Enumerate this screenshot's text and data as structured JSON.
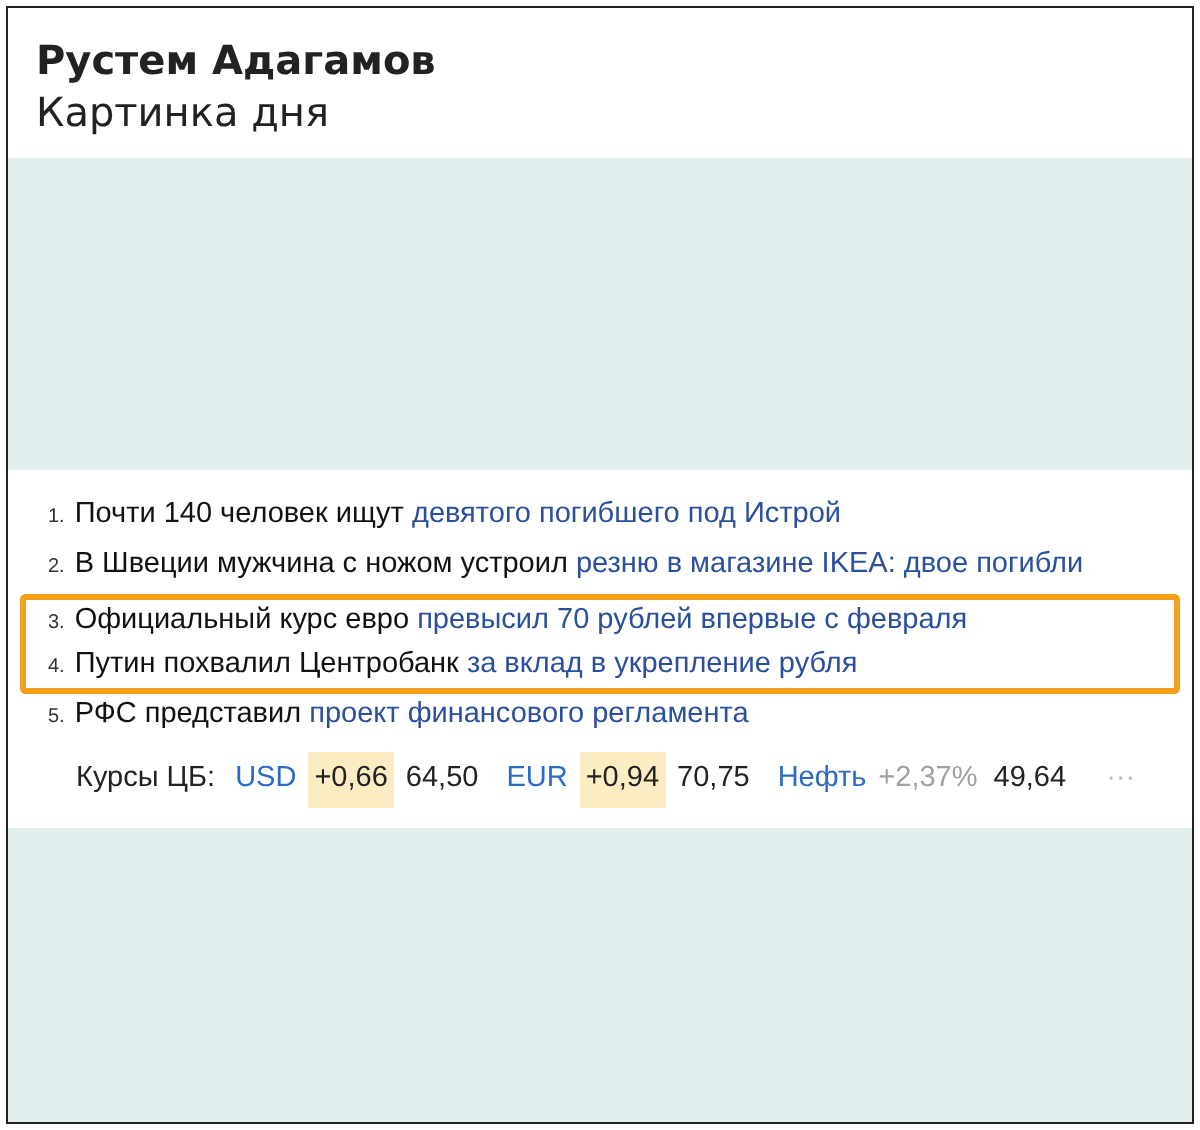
{
  "post": {
    "author": "Рустем Адагамов",
    "subtitle": "Картинка дня"
  },
  "news": [
    {
      "number": "1.",
      "text": "Почти 140 человек ищут",
      "link": "девятого погибшего под Истрой",
      "highlighted": false
    },
    {
      "number": "2.",
      "text": "В Швеции мужчина с ножом устроил",
      "link": "резню в магазине IKEA: двое погибли",
      "highlighted": false
    },
    {
      "number": "3.",
      "text": "Официальный курс евро",
      "link": "превысил 70 рублей впервые с февраля",
      "highlighted": true
    },
    {
      "number": "4.",
      "text": "Путин похвалил Центробанк",
      "link": "за вклад в укрепление рубля",
      "highlighted": true
    },
    {
      "number": "5.",
      "text": "РФС представил",
      "link": "проект финансового регламента",
      "highlighted": false
    }
  ],
  "rates": {
    "label": "Курсы ЦБ:",
    "items": [
      {
        "name": "USD",
        "change": "+0,66",
        "value": "64,50",
        "highlighted": true
      },
      {
        "name": "EUR",
        "change": "+0,94",
        "value": "70,75",
        "highlighted": true
      },
      {
        "name": "Нефть",
        "change": "+2,37%",
        "value": "49,64",
        "highlighted": false
      }
    ],
    "more": "···"
  }
}
